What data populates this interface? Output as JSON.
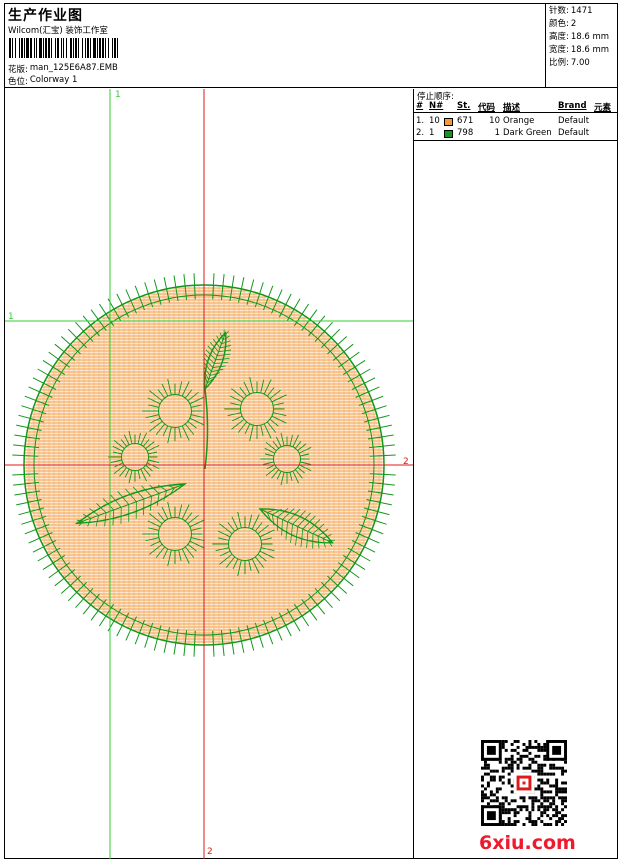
{
  "header": {
    "title": "生产作业图",
    "subtitle": "Wilcom(汇宝) 装饰工作室",
    "design_label": "花版:",
    "design_value": "man_125E6A87.EMB",
    "colorway_label": "色位:",
    "colorway_value": "Colorway 1"
  },
  "specs": [
    {
      "label": "针数:",
      "value": "1471"
    },
    {
      "label": "颜色:",
      "value": "2"
    },
    {
      "label": "高度:",
      "value": "18.6 mm"
    },
    {
      "label": "宽度:",
      "value": "18.6 mm"
    },
    {
      "label": "比例:",
      "value": "7.00"
    }
  ],
  "stop_sequence": {
    "title": "停止顺序:",
    "columns": {
      "num": "#",
      "needle": "N#",
      "st": "St.",
      "code": "代码",
      "desc": "描述",
      "brand": "Brand",
      "element": "元素"
    },
    "rows": [
      {
        "num": "1.",
        "needle": "10",
        "color": "#f59a3c",
        "st": "671",
        "code": "10",
        "desc": "Orange",
        "brand": "Default"
      },
      {
        "num": "2.",
        "needle": "1",
        "color": "#12981a",
        "st": "798",
        "code": "1",
        "desc": "Dark Green",
        "brand": "Default"
      }
    ]
  },
  "axes": {
    "v_green_label": "1",
    "h_green_label": "1",
    "h_red_label": "2",
    "v_red_label": "2"
  },
  "colors": {
    "orange": "#f59a3c",
    "green": "#12981a",
    "red": "#e01818",
    "light_green": "#33cc33"
  },
  "watermark": {
    "text": "6xiu.com",
    "qr_icon": "qr-code-icon"
  }
}
